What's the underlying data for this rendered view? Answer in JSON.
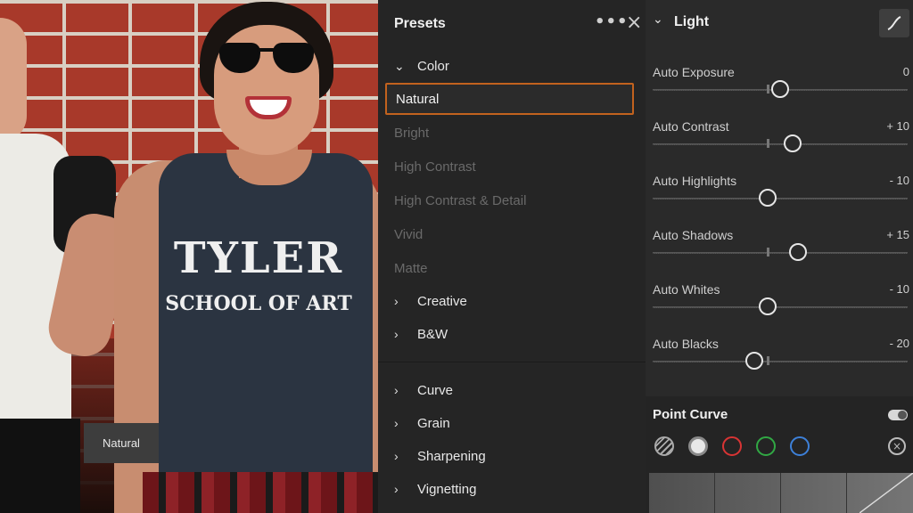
{
  "photo": {
    "shirt_line1": "TYLER",
    "shirt_line2": "SCHOOL OF ART",
    "tooltip": "Natural"
  },
  "presets": {
    "title": "Presets",
    "more_icon": "•••",
    "close_icon": "×",
    "color_group": "Color",
    "color_items": [
      "Natural",
      "Bright",
      "High Contrast",
      "High Contrast & Detail",
      "Vivid",
      "Matte"
    ],
    "selected": "Natural",
    "other_groups": [
      "Creative",
      "B&W"
    ],
    "sections": [
      "Curve",
      "Grain",
      "Sharpening",
      "Vignetting"
    ],
    "accent_color": "#c2621e"
  },
  "light": {
    "title": "Light",
    "sliders": [
      {
        "label": "Auto Exposure",
        "value": "0",
        "position": 0.5
      },
      {
        "label": "Auto Contrast",
        "value": "+ 10",
        "position": 0.55
      },
      {
        "label": "Auto Highlights",
        "value": "- 10",
        "position": 0.45
      },
      {
        "label": "Auto Shadows",
        "value": "+ 15",
        "position": 0.57
      },
      {
        "label": "Auto Whites",
        "value": "- 10",
        "position": 0.45
      },
      {
        "label": "Auto Blacks",
        "value": "- 20",
        "position": 0.4
      }
    ],
    "point_curve": {
      "title": "Point Curve",
      "channels": [
        "parametric",
        "rgb",
        "red",
        "green",
        "blue"
      ],
      "channel_colors": {
        "red": "#d83434",
        "green": "#31a844",
        "blue": "#3d80d8"
      }
    }
  }
}
